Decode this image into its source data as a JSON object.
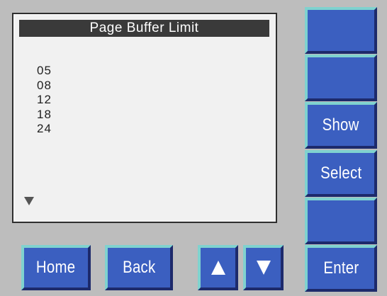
{
  "screen": {
    "title": "Page Buffer Limit",
    "options": [
      "05",
      "08",
      "12",
      "18",
      "24"
    ],
    "more_indicator": "down-triangle-icon"
  },
  "side_buttons": [
    {
      "label": ""
    },
    {
      "label": ""
    },
    {
      "label": "Show"
    },
    {
      "label": "Select"
    },
    {
      "label": ""
    },
    {
      "label": "Enter"
    }
  ],
  "bottom_buttons": {
    "home": "Home",
    "back": "Back",
    "up": "up-arrow-icon",
    "down": "down-arrow-icon"
  },
  "colors": {
    "panel": "#bdbdbd",
    "button_face": "#3b5fc0",
    "button_highlight": "#7fd2cf",
    "button_shadow": "#1d2a6b",
    "title_bar": "#3a3a3a"
  }
}
